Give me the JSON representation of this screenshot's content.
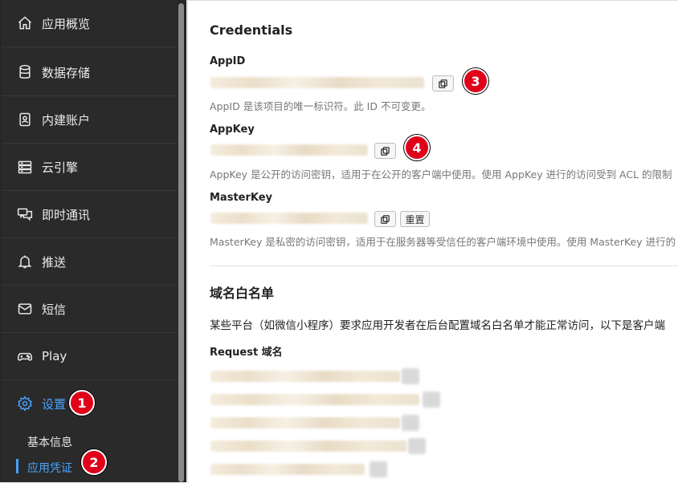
{
  "sidebar": {
    "items": [
      {
        "label": "应用概览",
        "icon": "home-icon"
      },
      {
        "label": "数据存储",
        "icon": "database-icon"
      },
      {
        "label": "内建账户",
        "icon": "contact-card-icon"
      },
      {
        "label": "云引擎",
        "icon": "server-icon"
      },
      {
        "label": "即时通讯",
        "icon": "chat-icon"
      },
      {
        "label": "推送",
        "icon": "bell-icon"
      },
      {
        "label": "短信",
        "icon": "mail-icon"
      },
      {
        "label": "Play",
        "icon": "gamepad-icon"
      },
      {
        "label": "设置",
        "icon": "gear-icon"
      }
    ],
    "subitems": [
      {
        "label": "基本信息"
      },
      {
        "label": "应用凭证"
      }
    ]
  },
  "annotations": [
    "1",
    "2",
    "3",
    "4"
  ],
  "credentials": {
    "title": "Credentials",
    "appid": {
      "label": "AppID",
      "help": "AppID 是该项目的唯一标识符。此 ID 不可变更。"
    },
    "appkey": {
      "label": "AppKey",
      "help": "AppKey 是公开的访问密钥，适用于在公开的客户端中使用。使用 AppKey 进行的访问受到 ACL 的限制"
    },
    "masterkey": {
      "label": "MasterKey",
      "help": "MasterKey 是私密的访问密钥，适用于在服务器等受信任的客户端环境中使用。使用 MasterKey 进行的",
      "reset_label": "重置"
    }
  },
  "whitelist": {
    "title": "域名白名单",
    "description": "某些平台（如微信小程序）要求应用开发者在后台配置域名白名单才能正常访问，以下是客户端",
    "request_label": "Request 域名"
  }
}
